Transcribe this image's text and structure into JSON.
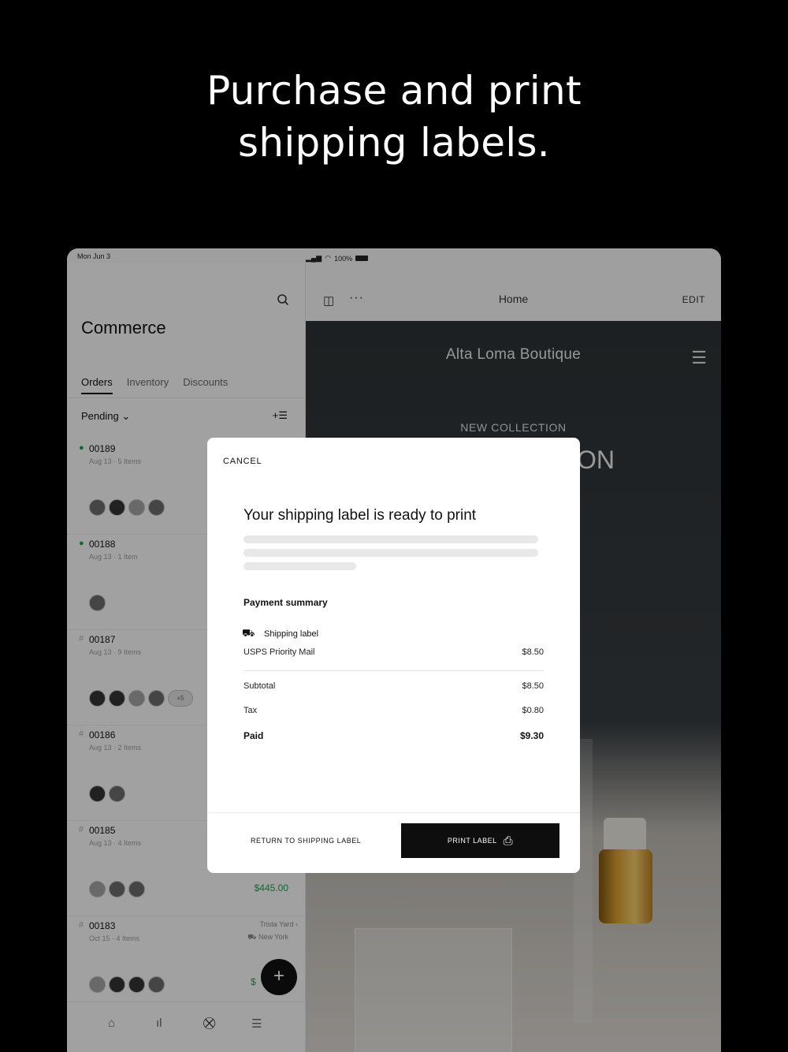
{
  "headline": {
    "line1": "Purchase and print",
    "line2": "shipping labels."
  },
  "status_bar": {
    "date": "Mon Jun 3",
    "signal": "▂▄▆",
    "wifi": "◠",
    "battery_pct": "100%"
  },
  "left_pane": {
    "app_title": "Commerce",
    "tabs": [
      {
        "label": "Orders",
        "active": true
      },
      {
        "label": "Inventory",
        "active": false
      },
      {
        "label": "Discounts",
        "active": false
      }
    ],
    "filter_label": "Pending ⌄",
    "filter_icon": "+☰",
    "orders": [
      {
        "mark": "●",
        "status": "new",
        "number": "00189",
        "meta": "Aug 13 · 5 Items"
      },
      {
        "mark": "●",
        "status": "new",
        "number": "00188",
        "meta": "Aug 13 · 1 Item"
      },
      {
        "mark": "#",
        "status": "pending",
        "number": "00187",
        "meta": "Aug 13 · 9 Items",
        "extra": "+5"
      },
      {
        "mark": "#",
        "status": "pending",
        "number": "00186",
        "meta": "Aug 13 · 2 Items"
      },
      {
        "mark": "#",
        "status": "pending",
        "number": "00185",
        "meta": "Aug 13 · 4 Items",
        "price": "$445.00"
      },
      {
        "mark": "#",
        "status": "pending",
        "number": "00183",
        "meta": "Oct 15 · 4 Items",
        "trailing1": "Trista Yard  ›",
        "trailing2": "⛟ New York"
      }
    ],
    "partial_price": "$",
    "fab": "+",
    "tabbar": {
      "home": "⌂",
      "analytics": "ıl",
      "commerce": "⛒",
      "menu": "☰"
    }
  },
  "right_pane": {
    "panel_icon": "◫",
    "dots": "···",
    "title": "Home",
    "edit_label": "EDIT",
    "site_name": "Alta Loma Boutique",
    "hamburger": "☰",
    "collection": "NEW COLLECTION",
    "collection_partial": "ON"
  },
  "modal": {
    "cancel_label": "CANCEL",
    "title": "Your shipping label is ready to print",
    "payment_summary_label": "Payment summary",
    "shipping_icon": "⛟",
    "shipping_label": "Shipping label",
    "service": "USPS Priority Mail",
    "service_price": "$8.50",
    "subtotal_label": "Subtotal",
    "subtotal": "$8.50",
    "tax_label": "Tax",
    "tax": "$0.80",
    "paid_label": "Paid",
    "paid": "$9.30",
    "return_label": "RETURN TO SHIPPING LABEL",
    "print_label": "PRINT LABEL",
    "print_icon": "⎙"
  }
}
